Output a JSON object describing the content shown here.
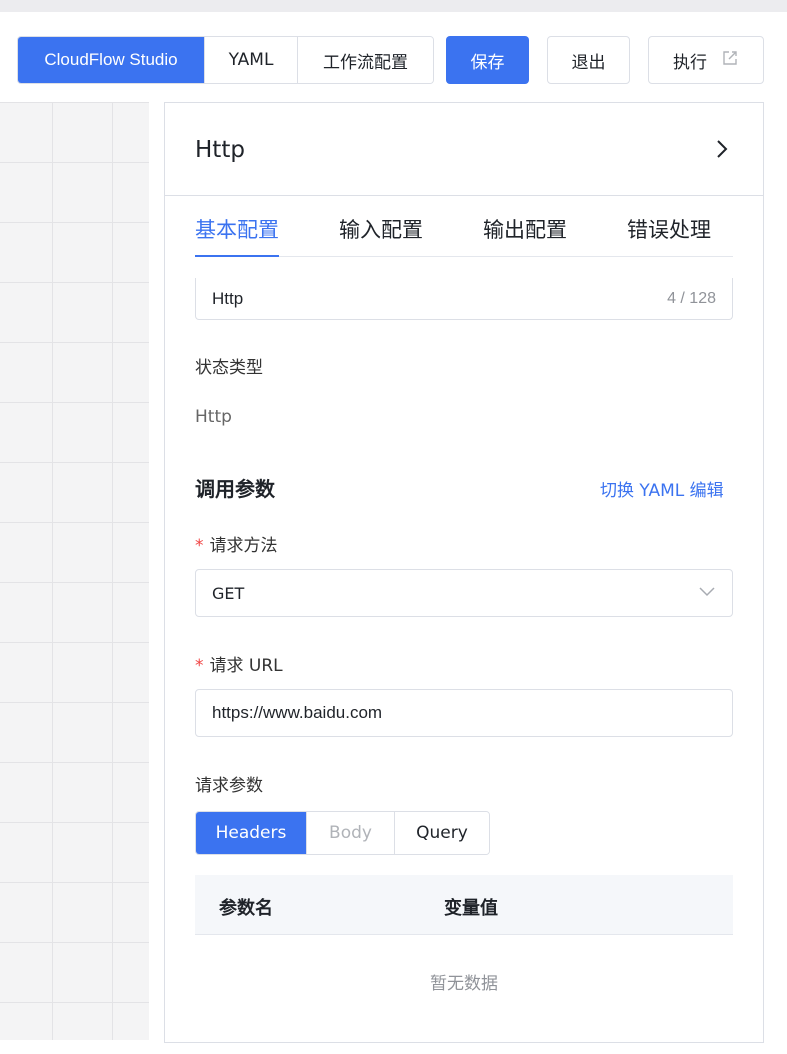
{
  "toolbar": {
    "app_tab": "CloudFlow Studio",
    "yaml_tab": "YAML",
    "workflow_tab": "工作流配置",
    "save": "保存",
    "exit": "退出",
    "run": "执行"
  },
  "panel": {
    "title": "Http",
    "tabs": [
      "基本配置",
      "输入配置",
      "输出配置",
      "错误处理"
    ],
    "active_tab": 0,
    "name_value": "Http",
    "name_count": "4 / 128",
    "state_type_label": "状态类型",
    "state_type_value": "Http",
    "section_title": "调用参数",
    "toggle_yaml_link": "切换 YAML 编辑",
    "method_label": "请求方法",
    "method_value": "GET",
    "url_label": "请求 URL",
    "url_value": "https://www.baidu.com",
    "params_label": "请求参数",
    "param_tabs": [
      "Headers",
      "Body",
      "Query"
    ],
    "table_headers": [
      "参数名",
      "变量值"
    ],
    "empty_text": "暂无数据"
  },
  "colors": {
    "primary": "#3b73f0",
    "required": "#f04444"
  }
}
